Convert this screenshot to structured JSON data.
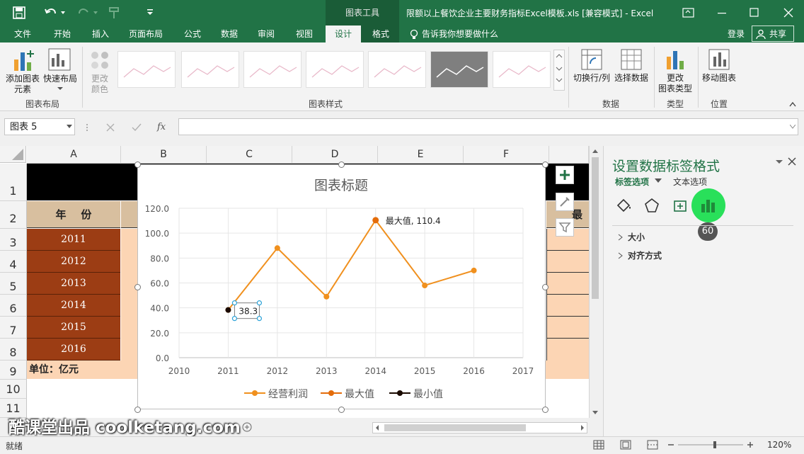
{
  "titlebar": {
    "context_tool": "图表工具",
    "title": "限额以上餐饮企业主要财务指标Excel模板.xls  [兼容模式] - Excel"
  },
  "tabs": [
    "文件",
    "开始",
    "插入",
    "页面布局",
    "公式",
    "数据",
    "审阅",
    "视图",
    "设计",
    "格式"
  ],
  "active_tab": "设计",
  "tell_me": "告诉我你想要做什么",
  "account": {
    "login": "登录",
    "share": "共享"
  },
  "ribbon": {
    "add_element": [
      "添加图表",
      "元素"
    ],
    "quick_layout": "快速布局",
    "change_color": [
      "更改",
      "颜色"
    ],
    "switch_rowcol": "切换行/列",
    "select_data": "选择数据",
    "change_type": [
      "更改",
      "图表类型"
    ],
    "move_chart": "移动图表",
    "groups": {
      "layout": "图表布局",
      "styles": "图表样式",
      "data": "数据",
      "type": "类型",
      "location": "位置"
    }
  },
  "formula_bar": {
    "name_box": "图表 5",
    "fx": "fx"
  },
  "columns": [
    "A",
    "B",
    "C",
    "D",
    "E",
    "F"
  ],
  "rows": [
    "1",
    "2",
    "3",
    "4",
    "5",
    "6",
    "7",
    "8",
    "9",
    "10",
    "11"
  ],
  "sheet": {
    "header_year": "年    份",
    "header_right": "最",
    "years": [
      "2011",
      "2012",
      "2013",
      "2014",
      "2015",
      "2016"
    ],
    "unit": "单位：亿元"
  },
  "chart_data": {
    "type": "line",
    "title": "图表标题",
    "x": [
      2011,
      2012,
      2013,
      2014,
      2015,
      2016
    ],
    "xlim": [
      2010,
      2017
    ],
    "ylim": [
      0,
      120
    ],
    "y_ticks": [
      "0.0",
      "20.0",
      "40.0",
      "60.0",
      "80.0",
      "100.0",
      "120.0"
    ],
    "x_ticks": [
      "2010",
      "2011",
      "2012",
      "2013",
      "2014",
      "2015",
      "2016",
      "2017"
    ],
    "series": [
      {
        "name": "经营利润",
        "values": [
          38.3,
          88,
          49,
          110.4,
          58,
          70
        ],
        "color": "#f0901e"
      },
      {
        "name": "最大值",
        "values": [
          null,
          null,
          null,
          110.4,
          null,
          null
        ],
        "color": "#e46c0a"
      },
      {
        "name": "最小值",
        "values": [
          38.3,
          null,
          null,
          null,
          null,
          null
        ],
        "color": "#1a0a00"
      }
    ],
    "labels": {
      "max": "最大值, 110.4",
      "min": "38.3"
    },
    "legend": "bottom",
    "grid": true
  },
  "pane": {
    "title": "设置数据标签格式",
    "tab1": "标签选项",
    "tab2": "文本选项",
    "badge": "60",
    "sections": [
      "大小",
      "对齐方式"
    ]
  },
  "status": {
    "ready": "就绪",
    "zoom": "120%"
  },
  "watermark": "酷课堂出品 coolketang.com"
}
